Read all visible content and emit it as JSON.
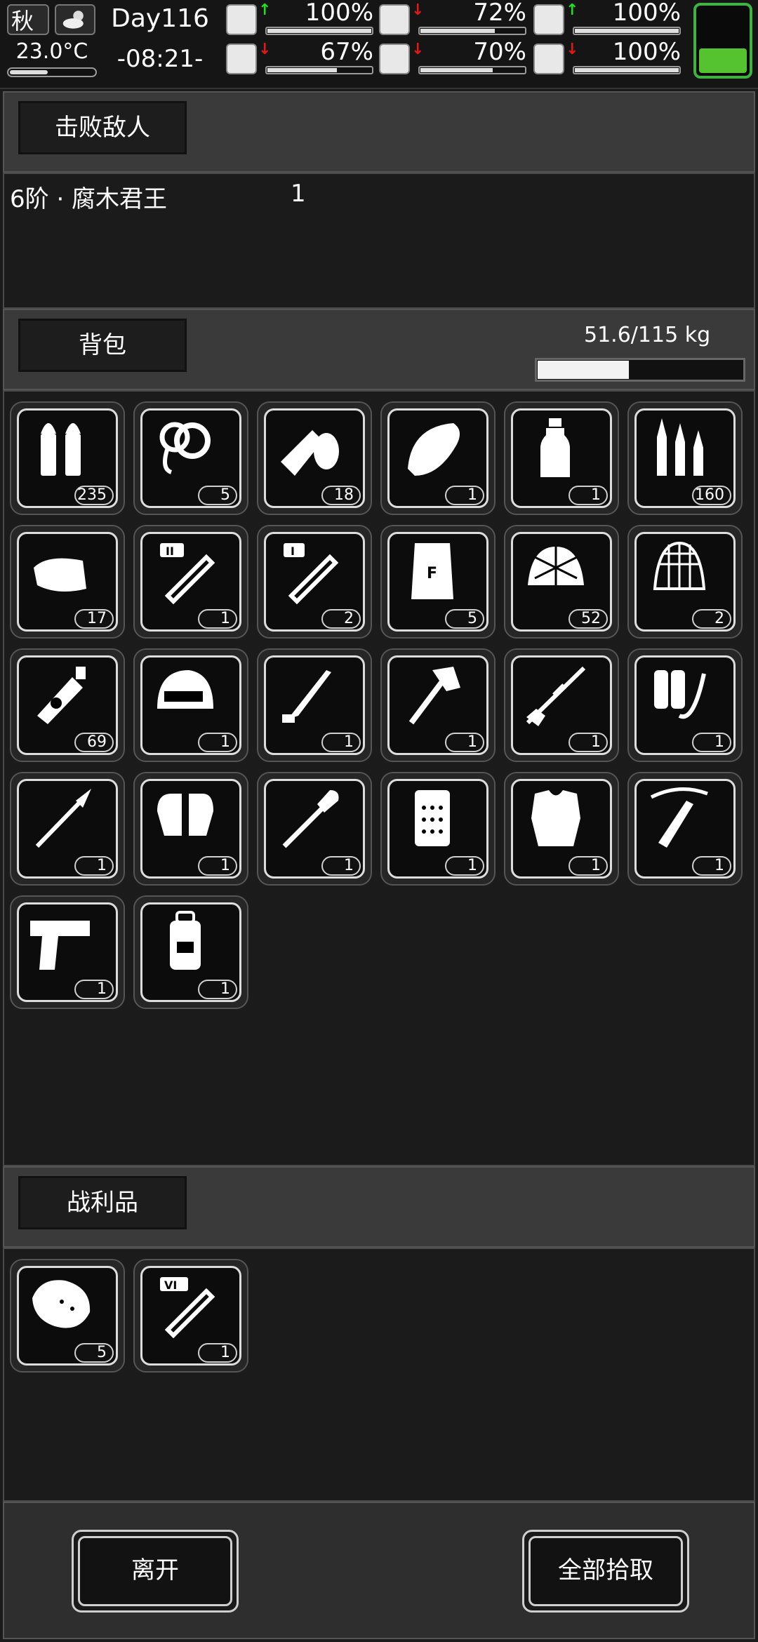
{
  "status": {
    "season": "秋",
    "temperature": "23.0°C",
    "temperature_level": 0.45,
    "day": "Day116",
    "time": "-08:21-",
    "battery_level": 0.35,
    "stats": [
      {
        "icon": "medkit-icon",
        "trend": "up",
        "percent": "100%",
        "value": 1.0
      },
      {
        "icon": "stomach-icon",
        "trend": "down",
        "percent": "72%",
        "value": 0.72
      },
      {
        "icon": "pill-icon",
        "trend": "up",
        "percent": "100%",
        "value": 1.0
      },
      {
        "icon": "leg-icon",
        "trend": "down",
        "percent": "67%",
        "value": 0.67
      },
      {
        "icon": "water-drop-icon",
        "trend": "down",
        "percent": "70%",
        "value": 0.7
      },
      {
        "icon": "heart-icon",
        "trend": "down",
        "percent": "100%",
        "value": 1.0
      }
    ]
  },
  "defeated": {
    "title": "击败敌人",
    "enemy_name": "6阶 · 腐木君王",
    "enemy_count": "1"
  },
  "backpack": {
    "title": "背包",
    "weight": "51.6/115 kg",
    "weight_fraction": 0.45,
    "items": [
      {
        "icon": "pistol-bullets-icon",
        "count": "235"
      },
      {
        "icon": "rope-icon",
        "count": "5"
      },
      {
        "icon": "bandage-icon",
        "count": "18"
      },
      {
        "icon": "bread-icon",
        "count": "1"
      },
      {
        "icon": "water-bottle-icon",
        "count": "1"
      },
      {
        "icon": "rifle-bullets-icon",
        "count": "160"
      },
      {
        "icon": "cloth-icon",
        "count": "17"
      },
      {
        "icon": "test-tube-ii-icon",
        "count": "1"
      },
      {
        "icon": "test-tube-i-icon",
        "count": "2"
      },
      {
        "icon": "flour-bag-icon",
        "count": "5"
      },
      {
        "icon": "net-helmet-icon",
        "count": "52"
      },
      {
        "icon": "trap-net-icon",
        "count": "2"
      },
      {
        "icon": "radiation-spray-icon",
        "count": "69"
      },
      {
        "icon": "helmet-icon",
        "count": "1"
      },
      {
        "icon": "machete-icon",
        "count": "1"
      },
      {
        "icon": "axe-icon",
        "count": "1"
      },
      {
        "icon": "rifle-icon",
        "count": "1"
      },
      {
        "icon": "flamethrower-icon",
        "count": "1"
      },
      {
        "icon": "spear-icon",
        "count": "1"
      },
      {
        "icon": "gloves-icon",
        "count": "1"
      },
      {
        "icon": "shovel-icon",
        "count": "1"
      },
      {
        "icon": "riot-shield-icon",
        "count": "1"
      },
      {
        "icon": "body-armor-icon",
        "count": "1"
      },
      {
        "icon": "crossbow-icon",
        "count": "1"
      },
      {
        "icon": "handgun-icon",
        "count": "1"
      },
      {
        "icon": "backpack-icon",
        "count": "1"
      }
    ]
  },
  "loot": {
    "title": "战利品",
    "items": [
      {
        "icon": "meat-icon",
        "count": "5"
      },
      {
        "icon": "test-tube-vi-icon",
        "count": "1"
      }
    ]
  },
  "actions": {
    "leave": "离开",
    "pick_all": "全部拾取"
  },
  "colors": {
    "trend_up": "#22dd22",
    "trend_down": "#e01818",
    "battery": "#55c22f"
  }
}
